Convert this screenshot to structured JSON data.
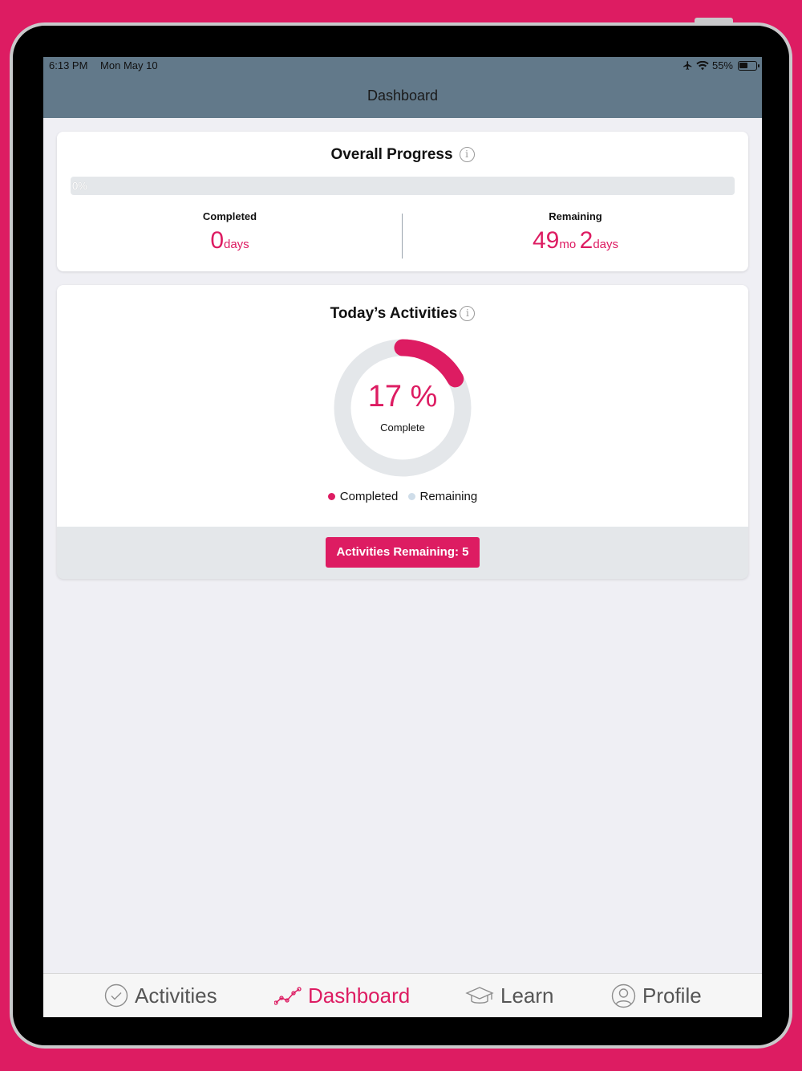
{
  "status_bar": {
    "time": "6:13 PM",
    "date": "Mon May 10",
    "battery": "55%",
    "battery_level": 0.55
  },
  "header": {
    "title": "Dashboard"
  },
  "overall_progress": {
    "title": "Overall Progress",
    "info_glyph": "i",
    "progress_label": "0%",
    "progress_value": 0,
    "completed": {
      "label": "Completed",
      "value": "0",
      "unit": "days"
    },
    "remaining": {
      "label": "Remaining",
      "months": "49",
      "months_unit": "mo",
      "days": "2",
      "days_unit": "days"
    }
  },
  "todays_activities": {
    "title": "Today’s Activities",
    "info_glyph": "i",
    "percent_text": "17 %",
    "percent_value": 17,
    "complete_label": "Complete",
    "legend": [
      {
        "label": "Completed",
        "color": "#dd1c62"
      },
      {
        "label": "Remaining",
        "color": "#cfdde9"
      }
    ],
    "remaining_button": "Activities Remaining: 5"
  },
  "tabs": [
    {
      "label": "Activities",
      "icon": "check-circle-icon"
    },
    {
      "label": "Dashboard",
      "icon": "line-chart-icon",
      "active": true
    },
    {
      "label": "Learn",
      "icon": "graduation-cap-icon"
    },
    {
      "label": "Profile",
      "icon": "user-circle-icon"
    }
  ],
  "colors": {
    "accent": "#dd1c62",
    "header": "#62798a",
    "track": "#e4e7ea",
    "background": "#efeff4"
  }
}
